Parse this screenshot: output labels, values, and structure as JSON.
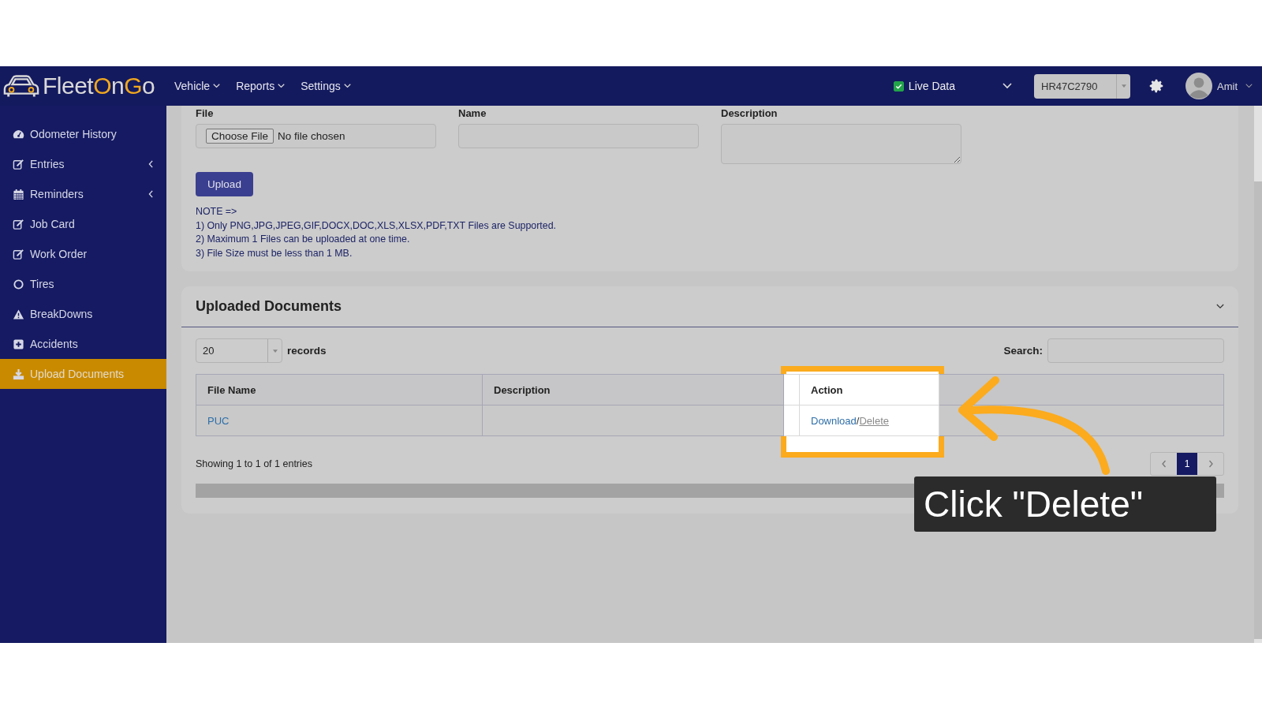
{
  "header": {
    "logo": [
      {
        "text": "Fleet",
        "accent": false
      },
      {
        "text": "O",
        "accent": true
      },
      {
        "text": "n",
        "accent": false
      },
      {
        "text": "G",
        "accent": true
      },
      {
        "text": "o",
        "accent": false
      }
    ],
    "nav": [
      "Vehicle",
      "Reports",
      "Settings"
    ],
    "live_data": {
      "label": "Live Data",
      "checked": true
    },
    "vehicle_select": "HR47C2790",
    "user": "Amit"
  },
  "sidebar": {
    "items": [
      {
        "label": "Odometer History",
        "expandable": false,
        "selected": false
      },
      {
        "label": "Entries",
        "expandable": true,
        "selected": false
      },
      {
        "label": "Reminders",
        "expandable": true,
        "selected": false
      },
      {
        "label": "Job Card",
        "expandable": false,
        "selected": false
      },
      {
        "label": "Work Order",
        "expandable": false,
        "selected": false
      },
      {
        "label": "Tires",
        "expandable": false,
        "selected": false
      },
      {
        "label": "BreakDowns",
        "expandable": false,
        "selected": false
      },
      {
        "label": "Accidents",
        "expandable": false,
        "selected": false
      },
      {
        "label": "Upload Documents",
        "expandable": false,
        "selected": true
      }
    ]
  },
  "upload_form": {
    "file_label": "File",
    "choose_button": "Choose File",
    "file_status": "No file chosen",
    "name_label": "Name",
    "description_label": "Description",
    "upload_button": "Upload",
    "notes": [
      "NOTE =>",
      "1) Only PNG,JPG,JPEG,GIF,DOCX,DOC,XLS,XLSX,PDF,TXT Files are Supported.",
      "2) Maximum 1 Files can be uploaded at one time.",
      "3) File Size must be less than 1 MB."
    ]
  },
  "documents": {
    "title": "Uploaded Documents",
    "page_size": "20",
    "records_label": "records",
    "search_label": "Search:",
    "columns": [
      "File Name",
      "Description",
      "Action"
    ],
    "rows": [
      {
        "file_name": "PUC",
        "download": "Download",
        "separator": "/",
        "delete": "Delete"
      }
    ],
    "info": "Showing 1 to 1 of 1 entries",
    "pages": [
      {
        "label": "1",
        "selected": true
      }
    ]
  },
  "callout": {
    "text": "Click \"Delete\""
  }
}
